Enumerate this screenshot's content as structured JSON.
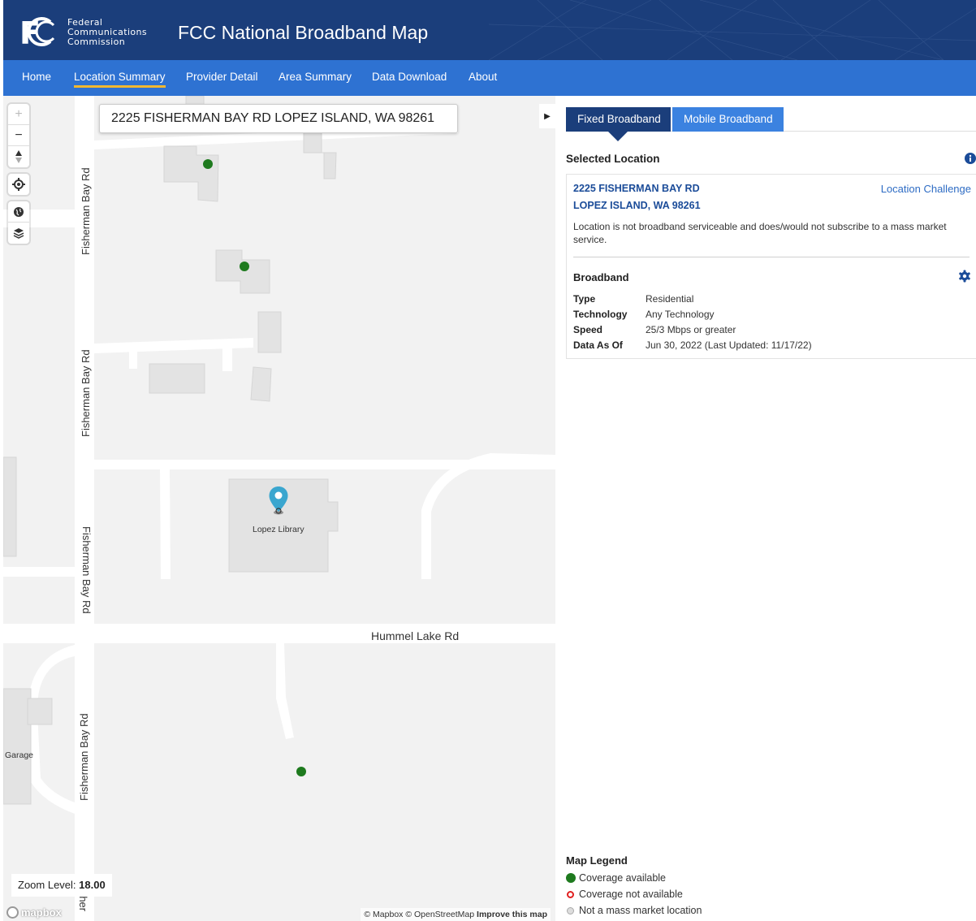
{
  "header": {
    "agency_name_lines": [
      "Federal",
      "Communications",
      "Commission"
    ],
    "site_title": "FCC National Broadband Map",
    "brand_color": "#1b3e7b"
  },
  "nav": {
    "items": [
      {
        "label": "Home"
      },
      {
        "label": "Location Summary",
        "active": true
      },
      {
        "label": "Provider Detail"
      },
      {
        "label": "Area Summary"
      },
      {
        "label": "Data Download"
      },
      {
        "label": "About"
      }
    ],
    "bar_color": "#2e72d2",
    "active_underline_color": "#f2b830"
  },
  "map": {
    "search_value": "2225 FISHERMAN BAY RD LOPEZ ISLAND, WA 98261",
    "controls": [
      "zoom-in-icon",
      "zoom-out-icon",
      "compass-icon",
      "locate-icon",
      "globe-icon",
      "layers-icon"
    ],
    "street_labels": {
      "fisherman_1": "Fisherman Bay Rd",
      "fisherman_2": "Fisherman Bay Rd",
      "fisherman_3": "Fisherman Bay Rd",
      "fisherman_4": "Fisherman Bay Rd",
      "fisherman_partial": "Fisher",
      "hummel": "Hummel Lake Rd"
    },
    "poi_labels": {
      "library": "Lopez Library",
      "garage": "Garage"
    },
    "zoom_label": "Zoom Level:",
    "zoom_value": "18.00",
    "mapbox_logo_text": "mapbox",
    "attribution": {
      "text": "© Mapbox © OpenStreetMap",
      "improve": "Improve this map"
    }
  },
  "panel": {
    "tabs": {
      "fixed": "Fixed Broadband",
      "mobile": "Mobile Broadband"
    },
    "selected_location_title": "Selected Location",
    "address_line1": "2225 FISHERMAN BAY RD",
    "address_line2": "LOPEZ ISLAND, WA 98261",
    "challenge_link": "Location Challenge",
    "status_text": "Location is not broadband serviceable and does/would not subscribe to a mass market service.",
    "broadband_title": "Broadband",
    "broadband_rows": [
      {
        "key": "Type",
        "value": "Residential"
      },
      {
        "key": "Technology",
        "value": "Any Technology"
      },
      {
        "key": "Speed",
        "value": "25/3 Mbps or greater"
      },
      {
        "key": "Data As Of",
        "value": "Jun 30, 2022 (Last Updated: 11/17/22)"
      }
    ],
    "legend": {
      "title": "Map Legend",
      "items": [
        {
          "label": "Coverage available",
          "color": "#1e7a1e"
        },
        {
          "label": "Coverage not available",
          "color": "#e02020"
        },
        {
          "label": "Not a mass market location",
          "color": "#cccccc"
        }
      ]
    }
  }
}
